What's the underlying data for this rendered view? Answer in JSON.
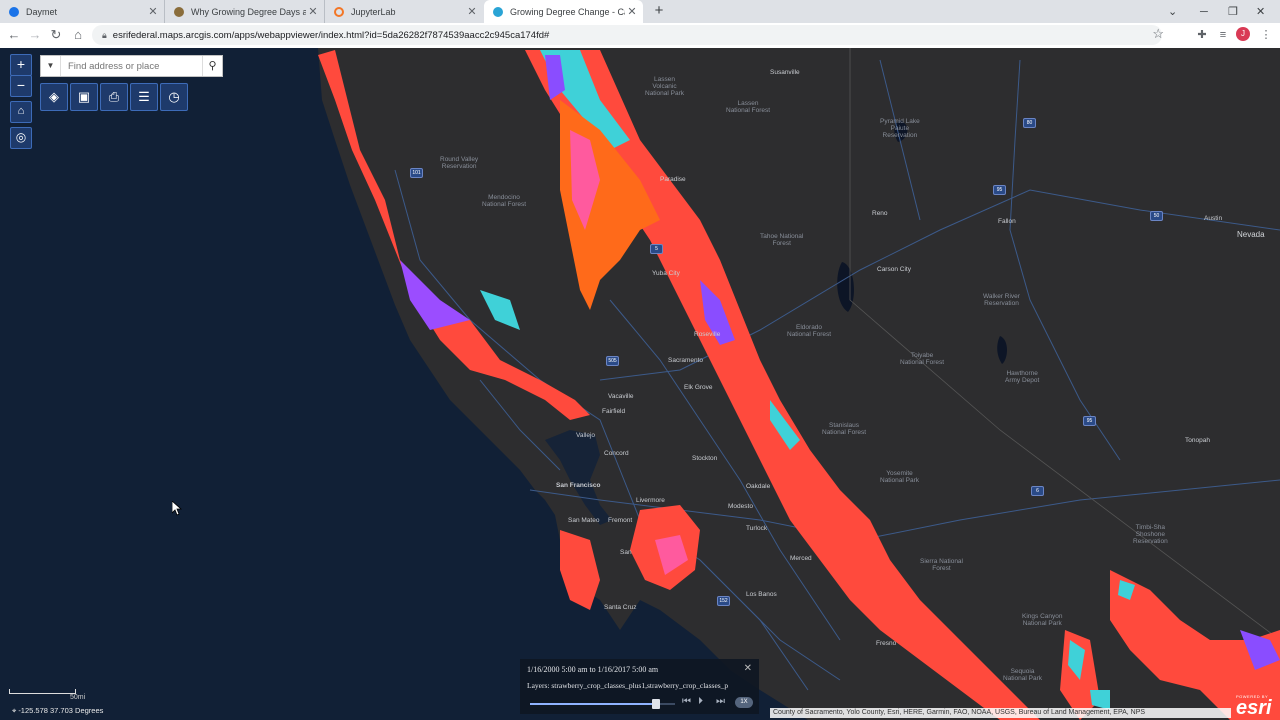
{
  "browser": {
    "tabs": [
      {
        "title": "Daymet",
        "color": "#1a73e8"
      },
      {
        "title": "Why Growing Degree Days are C",
        "color": "#8a6d3b"
      },
      {
        "title": "JupyterLab",
        "color": "#f37626"
      },
      {
        "title": "Growing Degree Change - Califo",
        "color": "#2aa4d5"
      }
    ],
    "url": "esrifederal.maps.arcgis.com/apps/webappviewer/index.html?id=5da26282f7874539aacc2c945ca174fd#",
    "profile_initial": "J"
  },
  "map": {
    "search_placeholder": "Find address or place",
    "labels": {
      "lassen": "Lassen\nVolcanic\nNational Park",
      "susanville": "Susanville",
      "lassen_nf": "Lassen\nNational Forest",
      "pyramid": "Pyramid Lake\nPaiute\nReservation",
      "round_valley": "Round Valley\nReservation",
      "mendocino": "Mendocino\nNational Forest",
      "paradise": "Paradise",
      "reno": "Reno",
      "fallon": "Fallon",
      "austin": "Austin",
      "nevada": "Nevada",
      "tahoe": "Tahoe National\nForest",
      "carson": "Carson City",
      "yuba": "Yuba City",
      "walker": "Walker River\nReservation",
      "roseville": "Roseville",
      "eldorado": "Eldorado\nNational Forest",
      "sacramento": "Sacramento",
      "elk_grove": "Elk Grove",
      "toiyabe": "Toiyabe\nNational Forest",
      "hawthorne": "Hawthorne\nArmy Depot",
      "vacaville": "Vacaville",
      "fairfield": "Fairfield",
      "vallejo": "Vallejo",
      "stanislaus": "Stanislaus\nNational Forest",
      "tonopah": "Tonopah",
      "concord": "Concord",
      "stockton": "Stockton",
      "yosemite": "Yosemite\nNational Park",
      "sf": "San Francisco",
      "oakdale": "Oakdale",
      "livermore": "Livermore",
      "modesto": "Modesto",
      "san_mateo": "San Mateo",
      "fremont": "Fremont",
      "turlock": "Turlock",
      "timbi": "Timbi-Sha\nShoshone\nReservation",
      "san_jose": "San",
      "merced": "Merced",
      "sierra": "Sierra National\nForest",
      "los_banos": "Los Banos",
      "santa_cruz": "Santa Cruz",
      "kings": "Kings Canyon\nNational Park",
      "fresno": "Fresno",
      "sequoia": "Sequoia\nNational Park"
    },
    "highways": [
      "80",
      "95",
      "50",
      "101",
      "5",
      "505",
      "6",
      "95",
      "152"
    ]
  },
  "time_slider": {
    "range": "1/16/2000 5:00 am to 1/16/2017 5:00 am",
    "layers": "Layers: strawberry_crop_classes_plus1,strawberry_crop_classes_p",
    "progress": 0.87,
    "speed": "1X"
  },
  "status": {
    "scale": "50mi",
    "coordinates": "-125.578 37.703 Degrees",
    "attribution": "County of Sacramento, Yolo County, Esri, HERE, Garmin, FAO, NOAA, USGS, Bureau of Land Management, EPA, NPS",
    "powered_by": "POWERED BY",
    "esri": "esri"
  },
  "colors": {
    "ocean": "#0f1a2b",
    "land": "#2d2d2f",
    "overlay_main": "#ff4a3d",
    "overlay_pink": "#ff5a9e",
    "overlay_cyan": "#3fd1d8",
    "overlay_purple": "#8a4dff",
    "overlay_orange": "#ff6a1a",
    "widget_blue": "#1e3a6b"
  }
}
